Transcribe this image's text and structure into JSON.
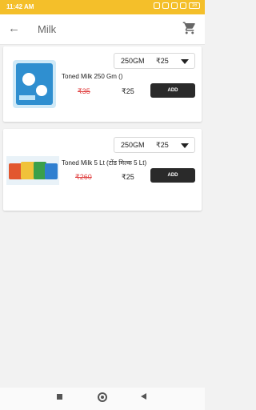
{
  "status_bar": {
    "time": "11:42 AM",
    "battery": "16"
  },
  "app_bar": {
    "back_icon": "back-arrow-icon",
    "title": "Milk",
    "cart_icon": "cart-icon"
  },
  "products": [
    {
      "name": "Toned Milk 250 Gm ()",
      "variant_size": "250GM",
      "variant_price": "₹25",
      "mrp": "₹35",
      "price": "₹25",
      "add_label": "ADD"
    },
    {
      "name": "Toned Milk 5 Lt (टोंड मिल्क 5 Lt)",
      "variant_size": "250GM",
      "variant_price": "₹25",
      "mrp": "₹260",
      "price": "₹25",
      "add_label": "ADD"
    }
  ],
  "colors": {
    "status_bar": "#f4bf2a",
    "add_button": "#2a2a2a",
    "mrp": "#e04040"
  }
}
